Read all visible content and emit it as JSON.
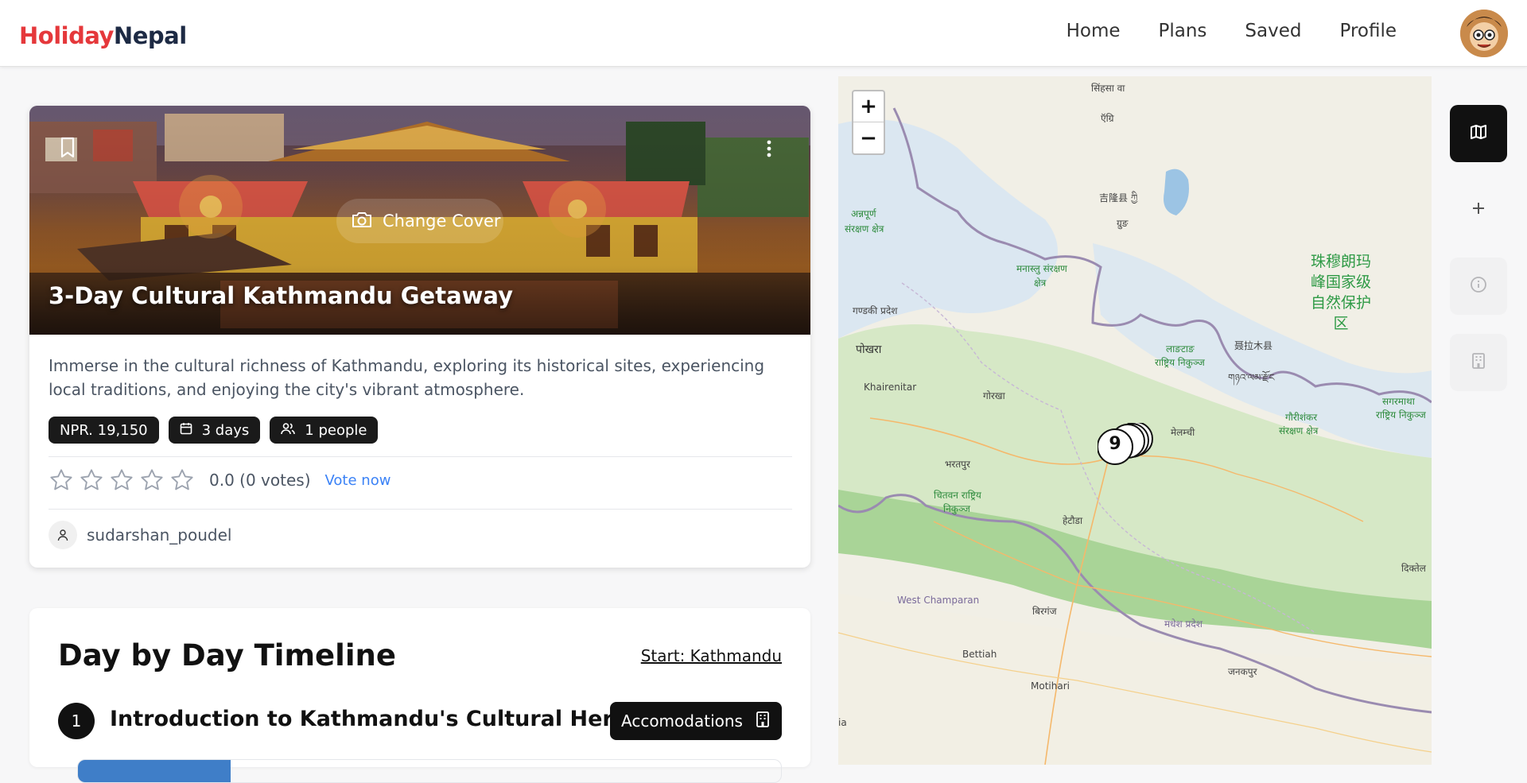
{
  "header": {
    "logo_part1": "Holiday",
    "logo_part2": "Nepal",
    "nav": [
      "Home",
      "Plans",
      "Saved",
      "Profile"
    ]
  },
  "plan": {
    "change_cover_label": "Change Cover",
    "title": "3-Day Cultural Kathmandu Getaway",
    "description": "Immerse in the cultural richness of Kathmandu, exploring its historical sites, experiencing local traditions, and enjoying the city's vibrant atmosphere.",
    "price": "NPR. 19,150",
    "duration": "3 days",
    "people": "1 people",
    "rating_text": "0.0 (0 votes)",
    "rating_value": 0,
    "rating_max": 5,
    "vote_label": "Vote now",
    "author": "sudarshan_poudel"
  },
  "timeline": {
    "title": "Day by Day Timeline",
    "start_label": "Start: Kathmandu",
    "days": [
      {
        "number": "1",
        "title": "Introduction to Kathmandu's Cultural Heritage",
        "accommodations_label": "Accomodations"
      }
    ]
  },
  "map": {
    "zoom_in": "+",
    "zoom_out": "−",
    "cluster_count": "9",
    "labels": {
      "l1": "सिंहसा वा",
      "l2": "ऍग्रि",
      "l3": "吉隆县 ཀྱི",
      "l4": "ग्रुङ",
      "l5": "अन्नपूर्ण",
      "l5b": "संरक्षण क्षेत्र",
      "l6": "मनास्लु संरक्षण",
      "l6b": "क्षेत्र",
      "l7": "गण्डकी प्रदेश",
      "l8": "पोखरा",
      "l9": "Khairenitar",
      "l10": "गोरखा",
      "l11": "लाङटाङ",
      "l11b": "राष्ट्रिय निकुञ्ज",
      "l12": "聂拉木县",
      "l13": "གཉའ་ལམ་རྫོང",
      "l14": "珠穆朗玛",
      "l14b": "峰国家级",
      "l14c": "自然保护",
      "l14d": "区",
      "l15": "मेलम्ची",
      "l16": "भरतपुर",
      "l17": "चितवन राष्ट्रिय",
      "l17b": "निकुञ्ज",
      "l18": "हेटौडा",
      "l19": "गौरीशंकर",
      "l19b": "संरक्षण क्षेत्र",
      "l20": "सगरमाथा",
      "l20b": "राष्ट्रिय निकुञ्ज",
      "l21": "दिक्तेल",
      "l22": "West Champaran",
      "l23": "बिरगंज",
      "l24": "मधेश प्रदेश",
      "l25": "Bettiah",
      "l26": "जनकपुर",
      "l27": "Motihari",
      "l28": "ia"
    }
  },
  "sidebar": {
    "buttons": [
      "map-icon",
      "plus-icon",
      "info-icon",
      "building-icon"
    ]
  },
  "colors": {
    "logo_red": "#e5383b",
    "logo_navy": "#1d2a44",
    "dark": "#111111",
    "link_blue": "#3b82f6",
    "map_green": "#2e9a45"
  }
}
